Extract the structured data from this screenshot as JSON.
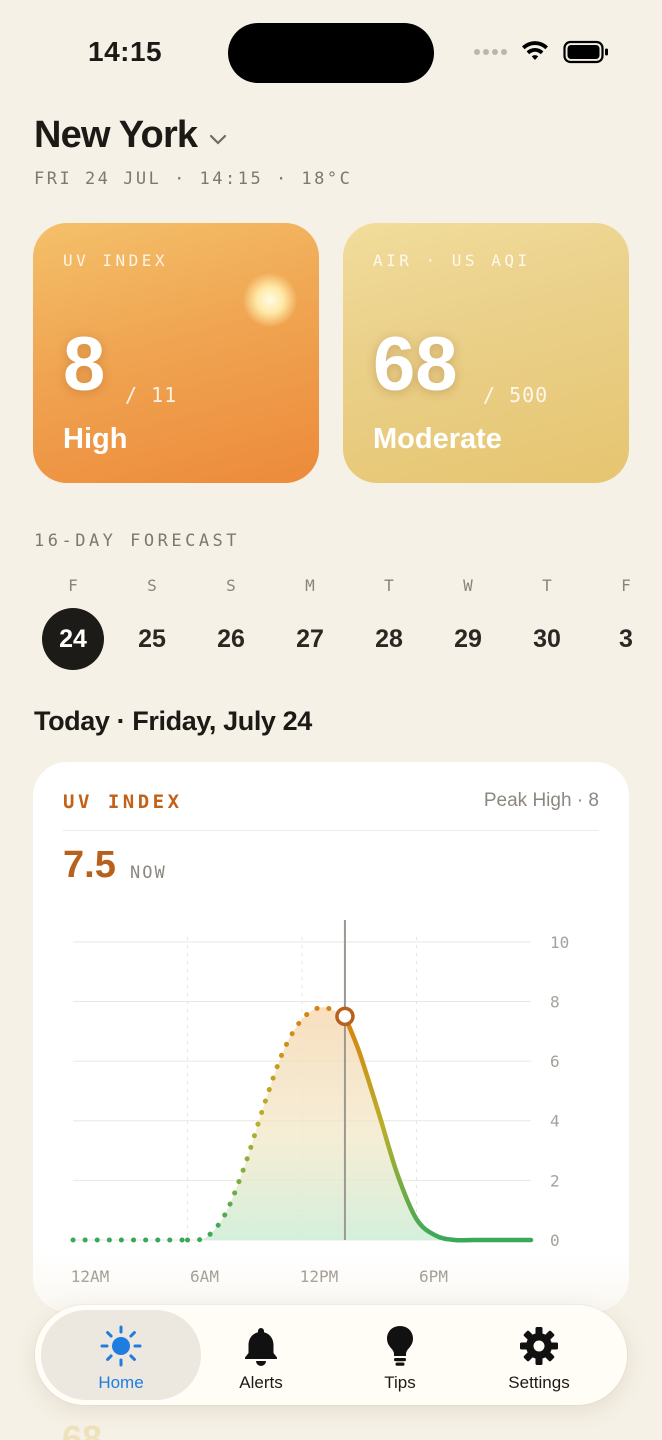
{
  "status": {
    "time": "14:15"
  },
  "header": {
    "city": "New York",
    "subline": "FRI 24 JUL · 14:15 · 18°C"
  },
  "tiles": {
    "uv": {
      "label": "UV INDEX",
      "value": "8",
      "max": "/ 11",
      "level": "High"
    },
    "aqi": {
      "label": "AIR · US AQI",
      "value": "68",
      "max": "/ 500",
      "level": "Moderate"
    }
  },
  "forecast": {
    "title": "16-DAY FORECAST",
    "days": [
      {
        "dow": "F",
        "date": "24"
      },
      {
        "dow": "S",
        "date": "25"
      },
      {
        "dow": "S",
        "date": "26"
      },
      {
        "dow": "M",
        "date": "27"
      },
      {
        "dow": "T",
        "date": "28"
      },
      {
        "dow": "W",
        "date": "29"
      },
      {
        "dow": "T",
        "date": "30"
      },
      {
        "dow": "F",
        "date": "3"
      }
    ],
    "selected_index": 0
  },
  "today": {
    "title": "Today · Friday, July 24"
  },
  "uv_card": {
    "label": "UV INDEX",
    "peak": "Peak High · 8",
    "now_value": "7.5",
    "now_label": "NOW"
  },
  "chart_data": {
    "type": "line",
    "x_tick_labels": [
      "12AM",
      "6AM",
      "12PM",
      "6PM"
    ],
    "y_ticks": [
      "0",
      "2",
      "4",
      "6",
      "8",
      "10"
    ],
    "ylim": [
      0,
      11
    ],
    "xlim": [
      0,
      24
    ],
    "grid": true,
    "current_hour": 14.25,
    "series": [
      {
        "x": [
          0,
          1,
          2,
          3,
          4,
          5,
          6,
          7,
          8,
          9,
          10,
          11,
          12,
          13,
          14,
          14.25,
          15,
          16,
          17,
          18,
          19,
          20,
          21,
          22,
          23,
          24
        ],
        "y": [
          0,
          0,
          0,
          0,
          0,
          0,
          0,
          0.1,
          0.9,
          2.5,
          4.5,
          6.3,
          7.4,
          7.8,
          7.6,
          7.5,
          6.3,
          4.3,
          2.2,
          0.7,
          0.15,
          0,
          0,
          0,
          0,
          0
        ]
      }
    ],
    "colors": {
      "past": "#e08a2c",
      "future_high": "#d9820f",
      "future_low": "#3aa85a",
      "marker": "#b8611c"
    }
  },
  "tabbar": {
    "tabs": [
      {
        "label": "Home",
        "icon": "sun-icon",
        "active": true
      },
      {
        "label": "Alerts",
        "icon": "bell-icon",
        "active": false
      },
      {
        "label": "Tips",
        "icon": "lightbulb-icon",
        "active": false
      },
      {
        "label": "Settings",
        "icon": "gear-icon",
        "active": false
      }
    ],
    "active_color": "#1f7de0"
  }
}
